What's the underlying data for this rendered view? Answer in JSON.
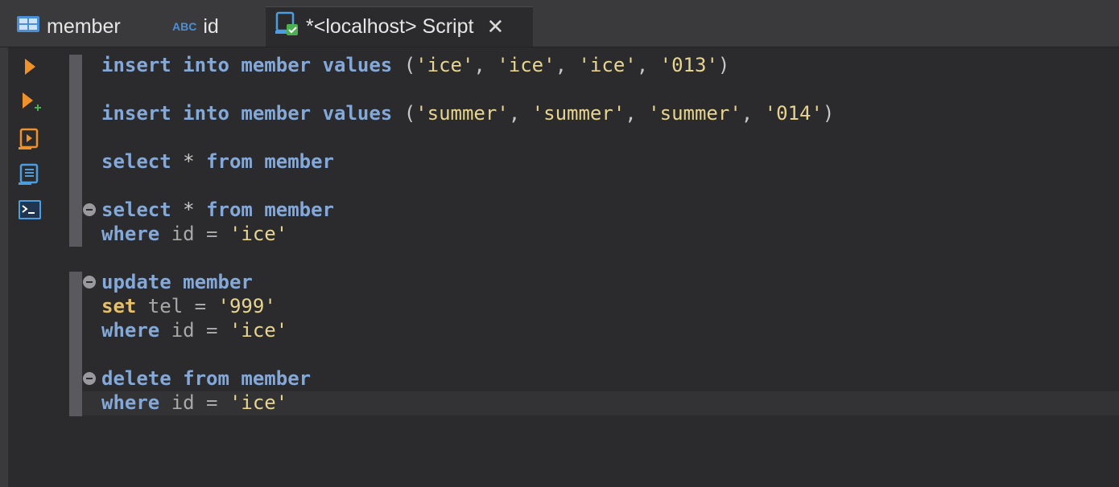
{
  "tabs": [
    {
      "label": "member",
      "icon": "table-icon"
    },
    {
      "label": "id",
      "icon": "abc-column-icon",
      "icon_text": "ABC"
    },
    {
      "label": "*<localhost> Script",
      "icon": "sql-script-icon",
      "close": "✕"
    }
  ],
  "toolbar": [
    {
      "name": "execute-statement-button",
      "icon": "play-icon"
    },
    {
      "name": "execute-in-new-tab-button",
      "icon": "play-plus-icon"
    },
    {
      "name": "execute-script-button",
      "icon": "script-run-icon"
    },
    {
      "name": "explain-plan-button",
      "icon": "document-list-icon"
    },
    {
      "name": "open-console-button",
      "icon": "terminal-icon"
    }
  ],
  "code": {
    "l1": {
      "k1": "insert",
      "k2": "into",
      "k3": "member",
      "k4": "values",
      "p1": " (",
      "s1": "'ice'",
      "s2": "'ice'",
      "s3": "'ice'",
      "s4": "'013'",
      "p2": ")"
    },
    "l2": {
      "k1": "insert",
      "k2": "into",
      "k3": "member",
      "k4": "values",
      "p1": " (",
      "s1": "'summer'",
      "s2": "'summer'",
      "s3": "'summer'",
      "s4": "'014'",
      "p2": ")"
    },
    "l3": {
      "k1": "select",
      "op": " * ",
      "k2": "from",
      "k3": "member"
    },
    "l4": {
      "k1": "select",
      "op": " * ",
      "k2": "from",
      "k3": "member"
    },
    "l5": {
      "k1": "where",
      "id": " id = ",
      "s1": "'ice'"
    },
    "l6": {
      "k1": "update",
      "k2": "member"
    },
    "l7": {
      "k1": "set",
      "id": " tel = ",
      "s1": "'999'"
    },
    "l8": {
      "k1": "where",
      "id": " id = ",
      "s1": "'ice'"
    },
    "l9": {
      "k1": "delete",
      "k2": "from",
      "k3": "member"
    },
    "l10": {
      "k1": "where",
      "id": " id = ",
      "s1": "'ice'"
    }
  },
  "comma": ", ",
  "space": " ",
  "colors": {
    "keyword": "#84a9d8",
    "set_keyword": "#e6c06a",
    "string": "#e7d48e",
    "identifier": "#a8a8a8",
    "background": "#2b2b2d",
    "toolbar_orange": "#f0922b",
    "toolbar_blue": "#4b9fe0"
  }
}
